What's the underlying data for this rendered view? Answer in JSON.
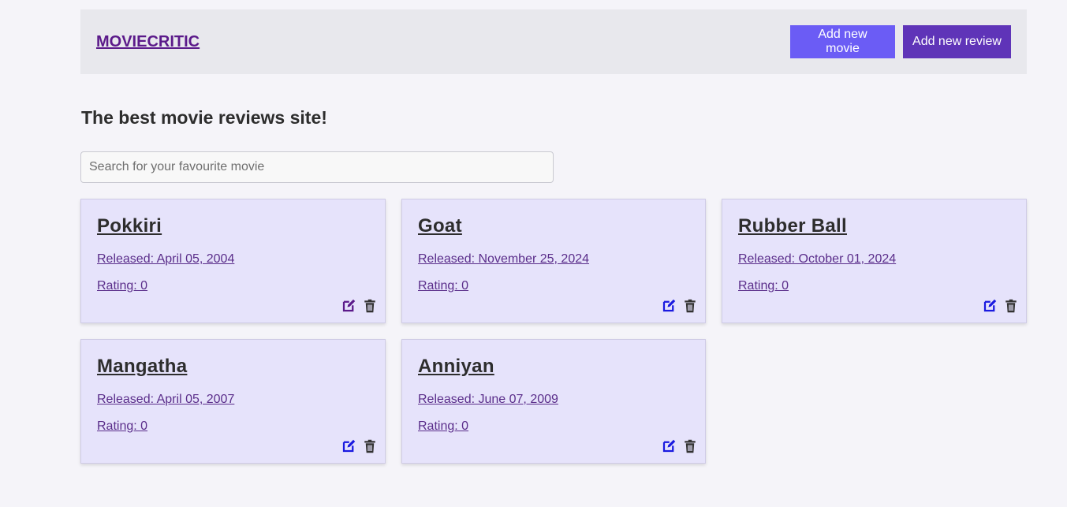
{
  "nav": {
    "brand": "MOVIECRITIC",
    "add_movie_label": "Add new movie",
    "add_review_label": "Add new review"
  },
  "tagline": "The best movie reviews site!",
  "search": {
    "placeholder": "Search for your favourite movie",
    "value": ""
  },
  "movies": [
    {
      "title": "Pokkiri",
      "released": "Released: April 05, 2004",
      "rating": "Rating: 0",
      "edit_color": "#5b1a8a"
    },
    {
      "title": "Goat",
      "released": "Released: November 25, 2024",
      "rating": "Rating: 0",
      "edit_color": "#1a1ae0"
    },
    {
      "title": "Rubber Ball",
      "released": "Released: October 01, 2024",
      "rating": "Rating: 0",
      "edit_color": "#1a1ae0"
    },
    {
      "title": "Mangatha",
      "released": "Released: April 05, 2007",
      "rating": "Rating: 0",
      "edit_color": "#1a1ae0"
    },
    {
      "title": "Anniyan",
      "released": "Released: June 07, 2009",
      "rating": "Rating: 0",
      "edit_color": "#1a1ae0"
    }
  ],
  "icons": {
    "edit": "edit-icon",
    "delete": "trash-icon"
  },
  "colors": {
    "add_movie_button": "#6b5cf5",
    "add_review_button": "#5f34b8",
    "card_bg": "#e6e3fb",
    "trash": "#333333"
  }
}
